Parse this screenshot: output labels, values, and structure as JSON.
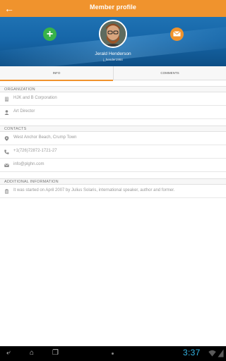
{
  "appbar": {
    "title": "Member profile"
  },
  "profile": {
    "name": "Jerald Henderson",
    "handle": "j_hender1984"
  },
  "tabs": [
    {
      "label": "INFO"
    },
    {
      "label": "COMMENTS"
    }
  ],
  "sections": {
    "organization": {
      "header": "ORGANIZATION",
      "company": "HJK and B Corporation",
      "role": "Art Director"
    },
    "contacts": {
      "header": "CONTACTS",
      "address": "West Anchor Beach, Crump Town",
      "phone": "+1(726)72872-1721-27",
      "email": "info@plghn.com"
    },
    "additional": {
      "header": "ADDITIONAL INFORMATION",
      "text": "It was started on April 2007 by Julius Solaris, international speaker, author and former."
    }
  },
  "statusbar": {
    "time": "3:37"
  },
  "colors": {
    "accent": "#f0932d",
    "hero": "#1666a8",
    "add": "#38b34a",
    "clock": "#35b5e5"
  }
}
